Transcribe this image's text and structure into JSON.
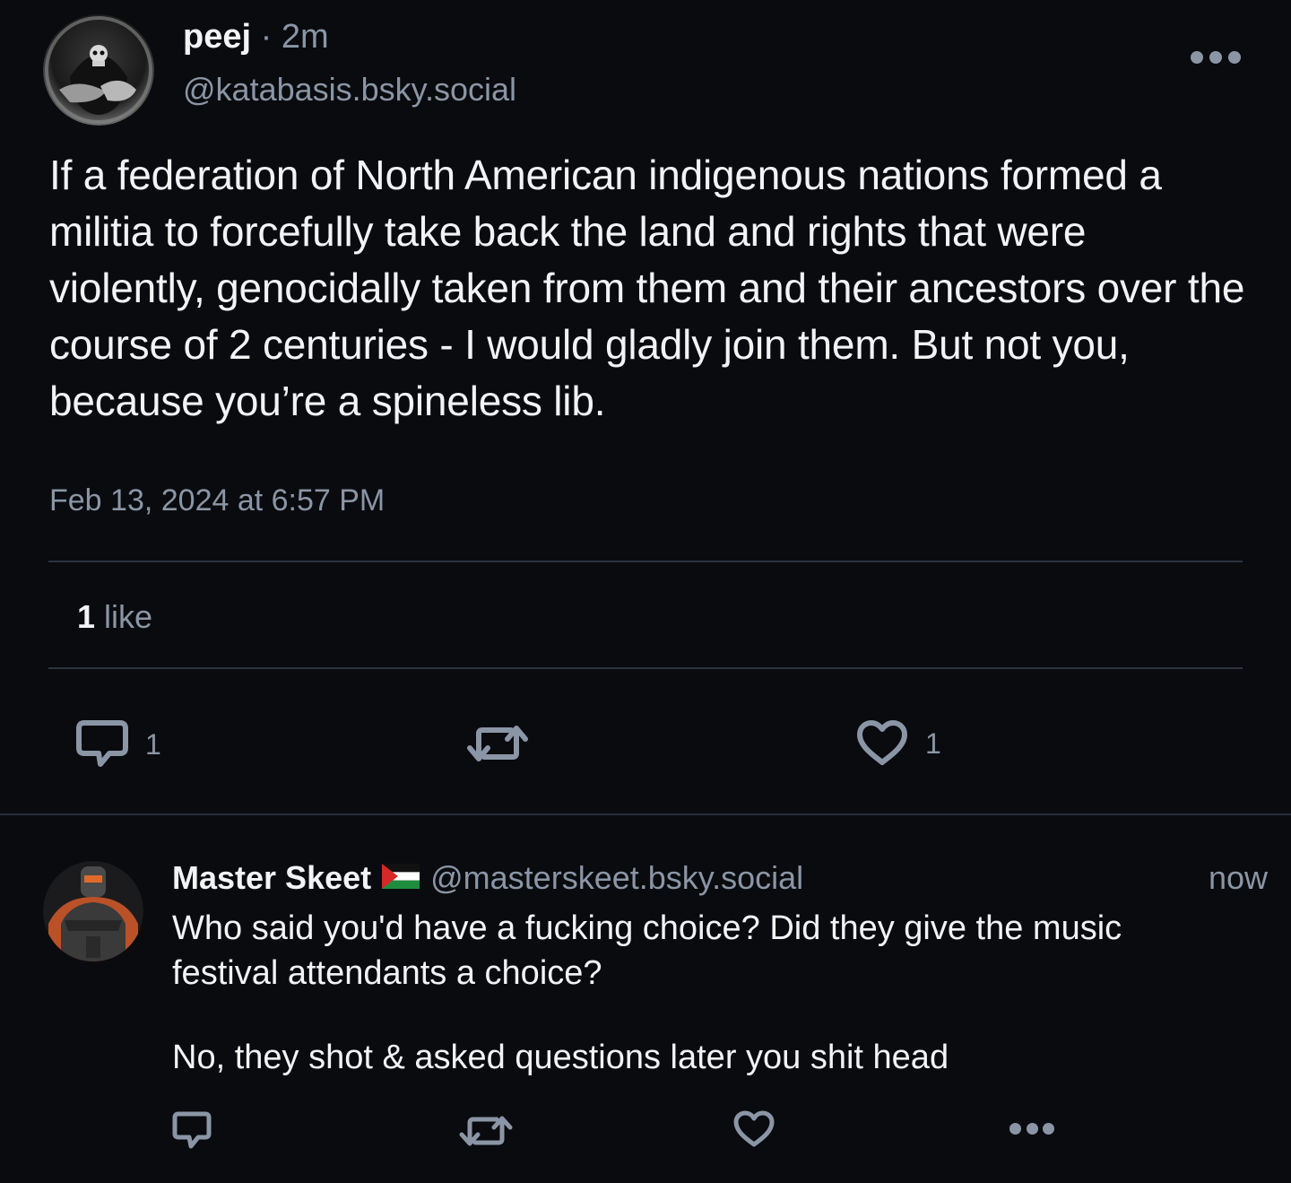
{
  "post": {
    "author_name": "peej",
    "separator": "·",
    "time_ago": "2m",
    "handle": "@katabasis.bsky.social",
    "text": "If a federation of North American indigenous nations formed a militia to forcefully take back the land and rights that were violently, genocidally taken from them and their ancestors over the course of 2 centuries - I would gladly join them. But not you, because you’re a spineless lib.",
    "timestamp": "Feb 13, 2024 at 6:57 PM",
    "likes_count": "1",
    "likes_label": "like",
    "reply_count": "1",
    "like_count": "1"
  },
  "reply": {
    "author_name": "Master Skeet",
    "handle": "@masterskeet.bsky.social",
    "time": "now",
    "paragraph_1": "Who said you'd have a fucking choice? Did they give the music festival attendants a choice?",
    "paragraph_2": "No, they shot & asked questions later you shit head"
  },
  "icons": {
    "reply": "speech-bubble-icon",
    "repost": "repost-arrows-icon",
    "like": "heart-outline-icon",
    "more": "ellipsis-icon",
    "flag": "palestine-flag-icon"
  },
  "colors": {
    "background": "#0a0b0e",
    "text_primary": "#f1f3f5",
    "text_secondary": "#8a96a6",
    "divider": "#2a3440"
  }
}
